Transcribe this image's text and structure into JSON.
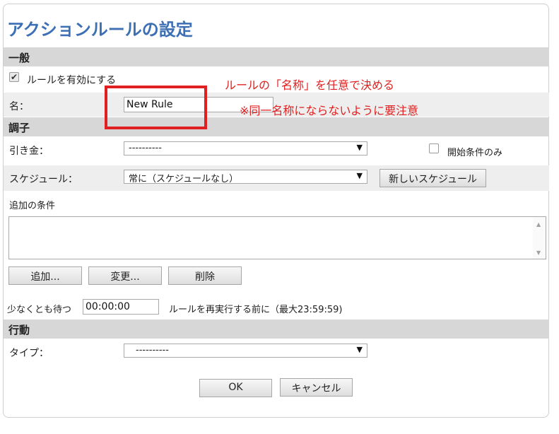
{
  "dialog": {
    "title": "アクションルールの設定"
  },
  "general": {
    "header": "一般",
    "enable_label": "ルールを有効にする",
    "enable_checked_glyph": "✔",
    "name_label": "名：",
    "name_value": "New Rule"
  },
  "condition": {
    "header": "調子",
    "trigger_label": "引き金：",
    "trigger_value": "----------",
    "start_only_label": "開始条件のみ",
    "schedule_label": "スケジュール：",
    "schedule_value": "常に（スケジュールなし）",
    "new_schedule_button": "新しいスケジュール",
    "additional_label": "追加の条件",
    "add_button": "追加...",
    "change_button": "変更...",
    "delete_button": "削除",
    "wait_label": "少なくとも待つ",
    "wait_value": "00:00:00",
    "wait_suffix": "ルールを再実行する前に（最大23:59:59)"
  },
  "action": {
    "header": "行動",
    "type_label": "タイプ：",
    "type_value": "----------"
  },
  "footer": {
    "ok": "OK",
    "cancel": "キャンセル"
  },
  "annotation": {
    "line1": "ルールの「名称」を任意で決める",
    "line2": "※同一名称にならないように要注意",
    "color": "#e02020"
  },
  "icons": {
    "dropdown_arrow": "▼",
    "scroll_up": "▲",
    "scroll_down": "▼"
  },
  "colors": {
    "title": "#3d6fb4",
    "section_bar": "#d7d7d7",
    "row_alt": "#eeeeee"
  }
}
